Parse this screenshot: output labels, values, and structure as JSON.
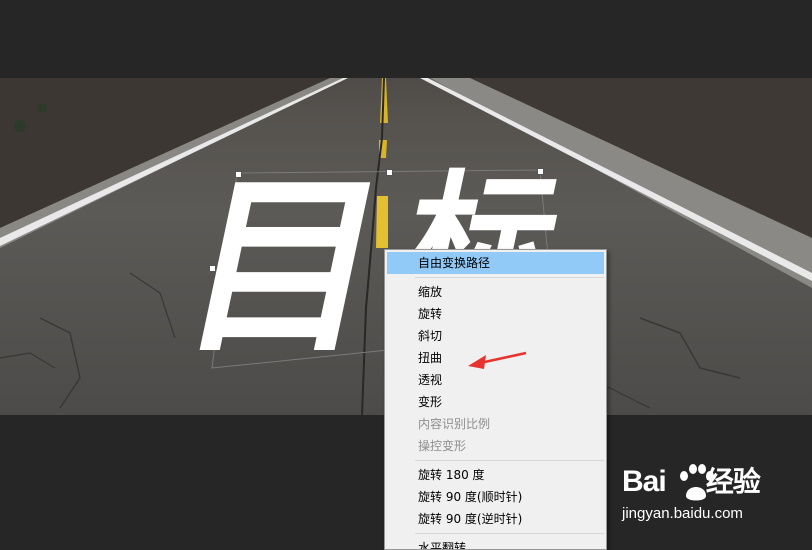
{
  "artwork": {
    "char1": "目",
    "char2": "标"
  },
  "context_menu": {
    "items": [
      {
        "label": "自由变换路径",
        "state": "highlighted"
      },
      {
        "separator": true
      },
      {
        "label": "缩放",
        "state": "normal"
      },
      {
        "label": "旋转",
        "state": "normal"
      },
      {
        "label": "斜切",
        "state": "normal"
      },
      {
        "label": "扭曲",
        "state": "normal"
      },
      {
        "label": "透视",
        "state": "normal"
      },
      {
        "label": "变形",
        "state": "normal"
      },
      {
        "label": "内容识别比例",
        "state": "disabled"
      },
      {
        "label": "操控变形",
        "state": "disabled"
      },
      {
        "separator": true
      },
      {
        "label": "旋转 180 度",
        "state": "normal"
      },
      {
        "label": "旋转 90 度(顺时针)",
        "state": "normal"
      },
      {
        "label": "旋转 90 度(逆时针)",
        "state": "normal"
      },
      {
        "separator": true
      },
      {
        "label": "水平翻转",
        "state": "normal"
      }
    ]
  },
  "annotation": {
    "icon": "red-arrow-icon",
    "color": "#e8322d"
  },
  "watermark": {
    "brand": "Bai",
    "brand_suffix": "经验",
    "url": "jingyan.baidu.com"
  },
  "colors": {
    "menu_highlight": "#91c9f7",
    "menu_background": "#f0f0f0",
    "workspace": "#262626"
  }
}
